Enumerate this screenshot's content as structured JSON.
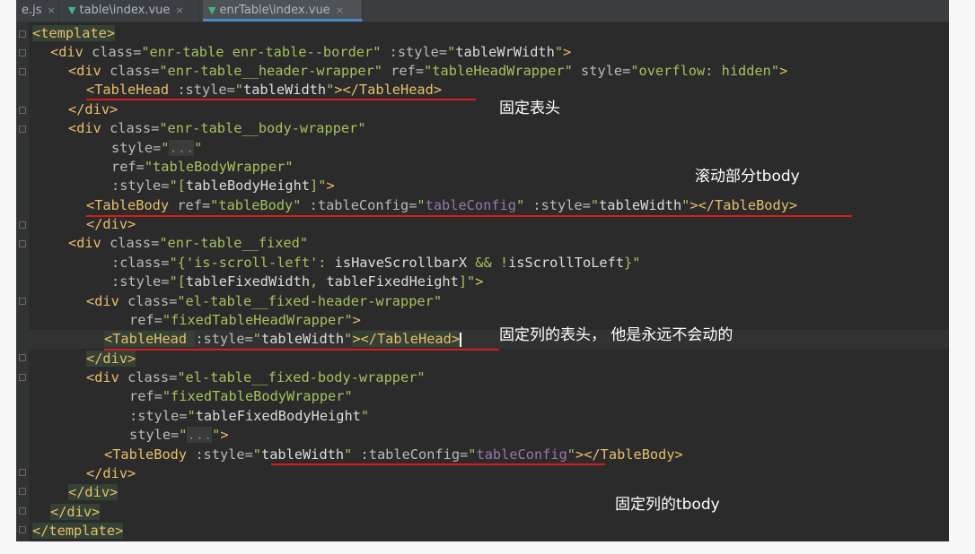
{
  "tabs": [
    {
      "label": "e.js",
      "close": "×"
    },
    {
      "label": "table\\index.vue",
      "close": "×"
    },
    {
      "label": "enrTable\\index.vue",
      "close": "×"
    }
  ],
  "code": {
    "l1": [
      "<template>"
    ],
    "l2": [
      "<div ",
      "class=",
      "\"enr-table enr-table--border\"",
      " :style=",
      "\"",
      "tableWrWidth",
      "\"",
      ">"
    ],
    "l3": [
      "<div ",
      "class=",
      "\"enr-table__header-wrapper\"",
      " ref=",
      "\"tableHeadWrapper\"",
      " style=",
      "\"overflow: hidden\"",
      ">"
    ],
    "l4": [
      "<TableHead ",
      ":style=",
      "\"",
      "tableWidth",
      "\"",
      "></TableHead>"
    ],
    "l5": [
      "</div>"
    ],
    "l6": [
      "<div ",
      "class=",
      "\"enr-table__body-wrapper\""
    ],
    "l7": [
      "style=",
      "\"",
      "...",
      "\""
    ],
    "l8": [
      "ref=",
      "\"tableBodyWrapper\""
    ],
    "l9": [
      ":style=",
      "\"[",
      "tableBodyHeight",
      "]\"",
      ">"
    ],
    "l10": [
      "<TableBody ",
      "ref=",
      "\"tableBody\"",
      " :tableConfig=",
      "\"",
      "tableConfig",
      "\"",
      " :style=",
      "\"",
      "tableWidth",
      "\"",
      "></TableBody>"
    ],
    "l11": [
      "</div>"
    ],
    "l12": [
      "<div ",
      "class=",
      "\"enr-table__fixed\""
    ],
    "l13": [
      ":class=",
      "\"{'is-scroll-left': ",
      "isHaveScrollbarX",
      " && !",
      "isScrollToLeft",
      "}\""
    ],
    "l14": [
      ":style=",
      "\"[",
      "tableFixedWidth",
      ", ",
      "tableFixedHeight",
      "]\"",
      ">"
    ],
    "l15": [
      "<div ",
      "class=",
      "\"el-table__fixed-header-wrapper\""
    ],
    "l16": [
      "ref=",
      "\"fixedTableHeadWrapper\"",
      ">"
    ],
    "l17": [
      "<TableHead ",
      ":style=",
      "\"",
      "tableWidth",
      "\"",
      "></TableHead>"
    ],
    "l18": [
      "</div>"
    ],
    "l19": [
      "<div ",
      "class=",
      "\"el-table__fixed-body-wrapper\""
    ],
    "l20": [
      "ref=",
      "\"fixedTableBodyWrapper\""
    ],
    "l21": [
      ":style=",
      "\"",
      "tableFixedBodyHeight",
      "\""
    ],
    "l22": [
      "style=",
      "\"",
      "...",
      "\"",
      ">"
    ],
    "l23": [
      "<TableBody ",
      ":style=",
      "\"",
      "tableWidth",
      "\"",
      " :tableConfig=",
      "\"",
      "tableConfig",
      "\"",
      "></TableBody>"
    ],
    "l24": [
      "</div>"
    ],
    "l25": [
      "</div>"
    ],
    "l26": [
      "</div>"
    ],
    "l27": [
      "</template>"
    ]
  },
  "annotations": {
    "fixed_header": "固定表头",
    "scroll_body": "滚动部分tbody",
    "fixed_col_header": "固定列的表头，  他是永远不会动的",
    "fixed_col_body": "固定列的tbody"
  },
  "colors": {
    "editor_bg": "#2b2b2b",
    "tag": "#e8bf6a",
    "string": "#a5c25c",
    "variable": "#9876aa",
    "annotation_underline": "#d81b1b"
  }
}
